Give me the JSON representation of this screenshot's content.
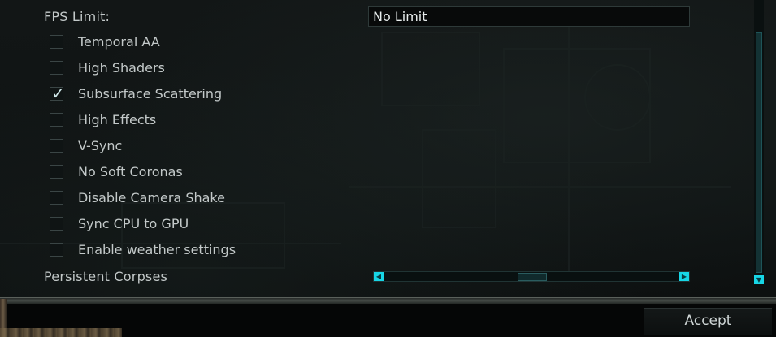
{
  "settings": {
    "fps_limit": {
      "label": "FPS Limit:",
      "value": "No Limit"
    },
    "checkboxes": [
      {
        "label": "Temporal AA",
        "checked": false
      },
      {
        "label": "High Shaders",
        "checked": false
      },
      {
        "label": "Subsurface Scattering",
        "checked": true
      },
      {
        "label": "High Effects",
        "checked": false
      },
      {
        "label": "V-Sync",
        "checked": false
      },
      {
        "label": "No Soft Coronas",
        "checked": false
      },
      {
        "label": "Disable Camera Shake",
        "checked": false
      },
      {
        "label": "Sync CPU to GPU",
        "checked": false
      },
      {
        "label": "Enable weather settings",
        "checked": false
      }
    ],
    "persistent_corpses": {
      "label": "Persistent Corpses",
      "slider_level": 0.5
    }
  },
  "footer": {
    "accept_label": "Accept"
  },
  "icons": {
    "check": "checkmark-icon",
    "slider_left": "arrow-left-icon",
    "slider_right": "arrow-right-icon",
    "scroll_down": "arrow-down-icon"
  },
  "colors": {
    "accent": "#17d6e6",
    "background": "#0f1313",
    "text": "#c3c9c9"
  }
}
